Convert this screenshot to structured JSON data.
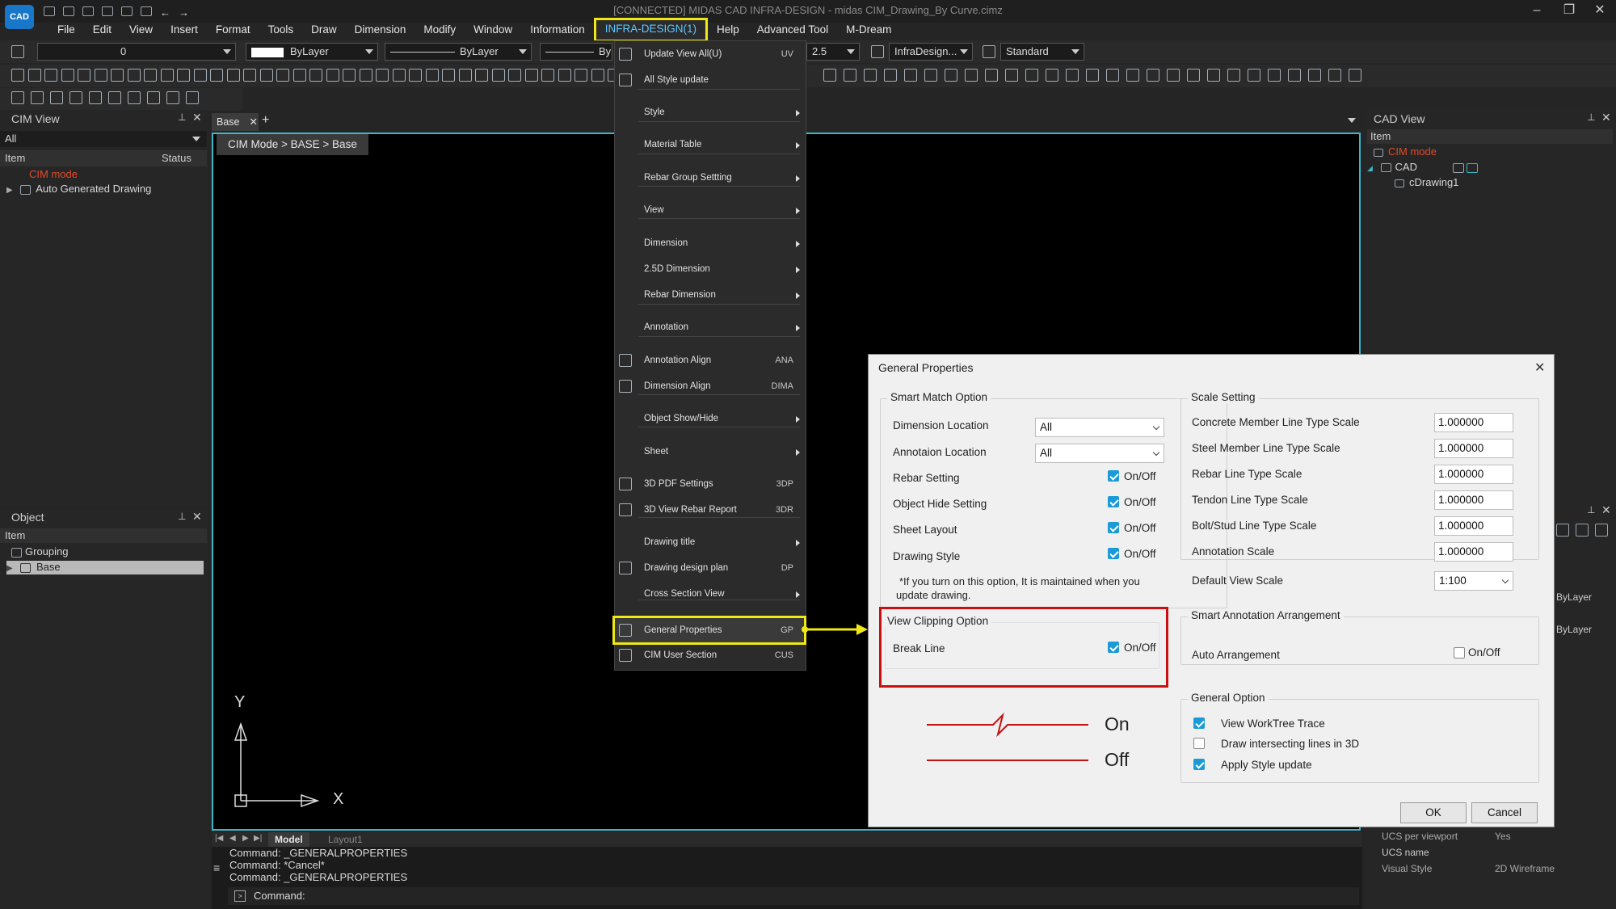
{
  "titlebar": {
    "logo": "CAD",
    "title": "[CONNECTED] MIDAS CAD INFRA-DESIGN - midas CIM_Drawing_By Curve.cimz",
    "minimize": "–",
    "restore": "❐",
    "close": "✕"
  },
  "menu": [
    "File",
    "Edit",
    "View",
    "Insert",
    "Format",
    "Tools",
    "Draw",
    "Dimension",
    "Modify",
    "Window",
    "Information",
    "INFRA-DESIGN(1)",
    "Help",
    "Advanced Tool",
    "M-Dream"
  ],
  "toolbar": {
    "layer_value": "0",
    "color_value": "ByLayer",
    "linetype_value": "ByLayer",
    "lineweight_value": "By",
    "scale_value": "2.5",
    "dimstyle_value": "InfraDesign...",
    "textstyle_value": "Standard"
  },
  "cim_view": {
    "title": "CIM View",
    "filter": "All",
    "col_item": "Item",
    "col_status": "Status",
    "items": [
      "CIM mode",
      "Auto Generated Drawing"
    ]
  },
  "object_panel": {
    "title": "Object",
    "col_item": "Item",
    "items": [
      "Grouping",
      "Base"
    ]
  },
  "drawing": {
    "tab": "Base",
    "add_tab": "+",
    "breadcrumb": "CIM Mode > BASE > Base",
    "axis_y": "Y",
    "axis_x": "X",
    "layout_tabs": [
      "Model",
      "Layout1"
    ]
  },
  "cad_view": {
    "title": "CAD View",
    "col_item": "Item",
    "items": [
      "CIM mode",
      "CAD",
      "cDrawing1"
    ]
  },
  "dropdown": {
    "items": [
      {
        "label": "Update View All(U)",
        "shortcut": "UV"
      },
      {
        "label": "All Style update",
        "shortcut": ""
      },
      {
        "label": "Style",
        "shortcut": ""
      },
      {
        "label": "Material Table",
        "shortcut": ""
      },
      {
        "label": "Rebar Group Settting",
        "shortcut": ""
      },
      {
        "label": "View",
        "shortcut": ""
      },
      {
        "label": "Dimension",
        "shortcut": ""
      },
      {
        "label": "2.5D Dimension",
        "shortcut": ""
      },
      {
        "label": "Rebar Dimension",
        "shortcut": ""
      },
      {
        "label": "Annotation",
        "shortcut": ""
      },
      {
        "label": "Annotation Align",
        "shortcut": "ANA"
      },
      {
        "label": "Dimension Align",
        "shortcut": "DIMA"
      },
      {
        "label": "Object Show/Hide",
        "shortcut": ""
      },
      {
        "label": "Sheet",
        "shortcut": ""
      },
      {
        "label": "3D PDF Settings",
        "shortcut": "3DP"
      },
      {
        "label": "3D View Rebar Report",
        "shortcut": "3DR"
      },
      {
        "label": "Drawing title",
        "shortcut": ""
      },
      {
        "label": "Drawing design plan",
        "shortcut": "DP"
      },
      {
        "label": "Cross Section View",
        "shortcut": ""
      },
      {
        "label": "General Properties",
        "shortcut": "GP"
      },
      {
        "label": "CIM User Section",
        "shortcut": "CUS"
      }
    ]
  },
  "dialog": {
    "title": "General Properties",
    "smart_match": {
      "title": "Smart Match Option",
      "dimension_location": {
        "label": "Dimension Location",
        "value": "All"
      },
      "annotation_location": {
        "label": "Annotaion Location",
        "value": "All"
      },
      "rebar_setting": {
        "label": "Rebar Setting",
        "toggle": "On/Off"
      },
      "object_hide": {
        "label": "Object Hide Setting",
        "toggle": "On/Off"
      },
      "sheet_layout": {
        "label": "Sheet Layout",
        "toggle": "On/Off"
      },
      "drawing_style": {
        "label": "Drawing Style",
        "toggle": "On/Off"
      },
      "note": "*If you turn on this option, It is maintained when you update drawing."
    },
    "view_clipping": {
      "title": "View Clipping Option",
      "break_line": {
        "label": "Break Line",
        "toggle": "On/Off"
      }
    },
    "legend": {
      "on": "On",
      "off": "Off"
    },
    "scale": {
      "title": "Scale Setting",
      "rows": [
        {
          "label": "Concrete Member Line Type Scale",
          "value": "1.000000"
        },
        {
          "label": "Steel Member Line Type Scale",
          "value": "1.000000"
        },
        {
          "label": "Rebar Line Type Scale",
          "value": "1.000000"
        },
        {
          "label": "Tendon Line Type Scale",
          "value": "1.000000"
        },
        {
          "label": "Bolt/Stud Line Type Scale",
          "value": "1.000000"
        },
        {
          "label": "Annotation Scale",
          "value": "1.000000"
        }
      ],
      "default_view_scale": {
        "label": "Default View Scale",
        "value": "1:100"
      }
    },
    "smart_annotation": {
      "title": "Smart Annotation Arrangement",
      "auto_arrangement": {
        "label": "Auto Arrangement",
        "toggle": "On/Off"
      }
    },
    "general_option": {
      "title": "General Option",
      "view_worktree": "View WorkTree Trace",
      "draw_intersecting": "Draw intersecting lines in 3D",
      "apply_style": "Apply Style update"
    },
    "ok": "OK",
    "cancel": "Cancel"
  },
  "properties": {
    "bylayer1": "ByLayer",
    "bylayer2": "ByLayer",
    "ucs_per_viewport": {
      "label": "UCS per viewport",
      "value": "Yes"
    },
    "ucs_name": {
      "label": "UCS name",
      "value": ""
    },
    "visual_style": {
      "label": "Visual Style",
      "value": "2D Wireframe"
    }
  },
  "command": {
    "lines": [
      "Command: _GENERALPROPERTIES",
      "Command: *Cancel*",
      "Command: _GENERALPROPERTIES"
    ],
    "prompt": "Command:"
  },
  "colors": {
    "accent": "#3fb5c9",
    "highlight": "#f0e816",
    "cim_mode": "#e34a2b",
    "break_line": "#c81010",
    "checkbox": "#1a9bd7",
    "clip_box": "#c81010"
  }
}
